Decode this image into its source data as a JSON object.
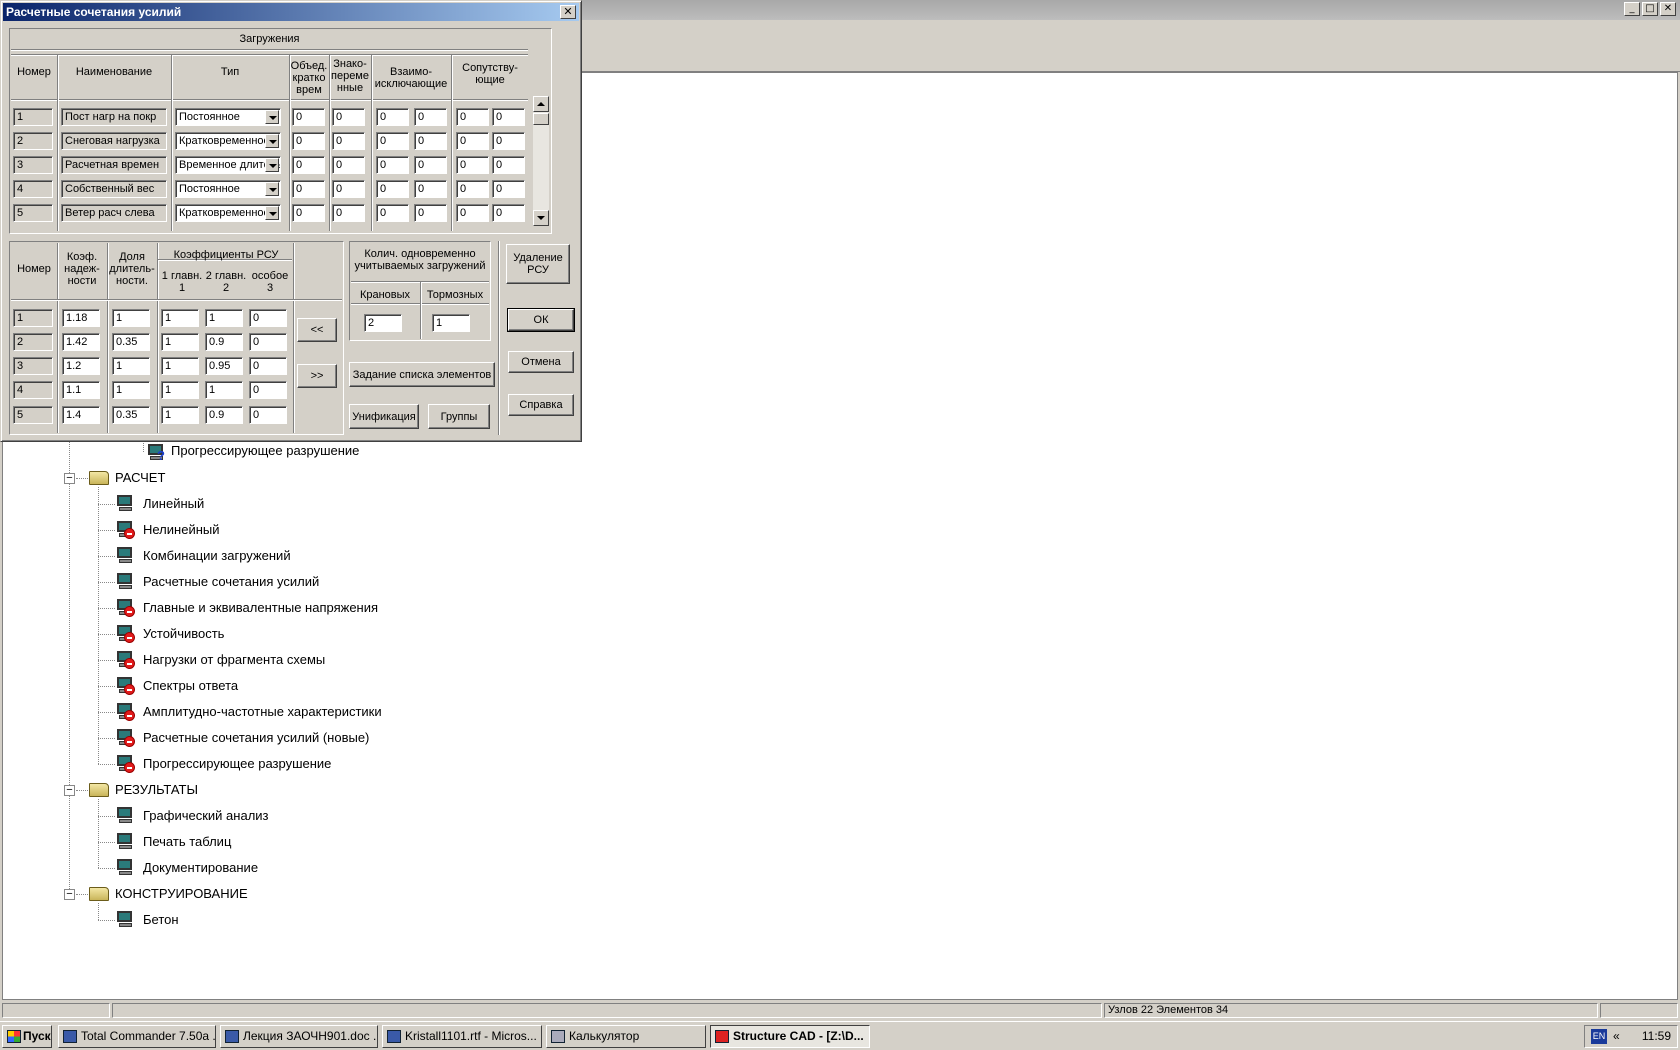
{
  "dialog": {
    "title": "Расчетные сочетания усилий",
    "close_glyph": "✕",
    "loads_group": "Загружения",
    "loads_headers": {
      "num": "Номер",
      "name": "Наименование",
      "type": "Тип",
      "combined": [
        "Объед.",
        "кратко",
        "врем"
      ],
      "alternating": [
        "Знако-",
        "переме",
        "нные"
      ],
      "mutual": [
        "Взаимо-",
        "исключающие"
      ],
      "accompanying": [
        "Сопутству-",
        "ющие"
      ]
    },
    "loads": [
      {
        "num": "1",
        "name": "Пост нагр на покр",
        "type": "Постоянное",
        "c1": "0",
        "c2": "0",
        "c3": "0",
        "c4": "0",
        "c5": "0",
        "c6": "0"
      },
      {
        "num": "2",
        "name": "Снеговая нагрузка",
        "type": "Кратковременное",
        "c1": "0",
        "c2": "0",
        "c3": "0",
        "c4": "0",
        "c5": "0",
        "c6": "0"
      },
      {
        "num": "3",
        "name": "Расчетная времен",
        "type": "Временное длительное",
        "c1": "0",
        "c2": "0",
        "c3": "0",
        "c4": "0",
        "c5": "0",
        "c6": "0"
      },
      {
        "num": "4",
        "name": "Собственный вес",
        "type": "Постоянное",
        "c1": "0",
        "c2": "0",
        "c3": "0",
        "c4": "0",
        "c5": "0",
        "c6": "0"
      },
      {
        "num": "5",
        "name": "Ветер расч слева",
        "type": "Кратковременное",
        "c1": "0",
        "c2": "0",
        "c3": "0",
        "c4": "0",
        "c5": "0",
        "c6": "0"
      }
    ],
    "coef_headers": {
      "num": "Номер",
      "reliability": [
        "Коэф.",
        "надеж-",
        "ности"
      ],
      "duration": [
        "Доля",
        "длитель-",
        "ности."
      ],
      "rsu_group": "Коэффициенты РСУ",
      "main1": [
        "1 главн.",
        "1"
      ],
      "main2": [
        "2 главн.",
        "2"
      ],
      "special": [
        "особое",
        "3"
      ]
    },
    "coefs": [
      {
        "num": "1",
        "rel": "1.18",
        "dur": "1",
        "k1": "1",
        "k2": "1",
        "k3": "0"
      },
      {
        "num": "2",
        "rel": "1.42",
        "dur": "0.35",
        "k1": "1",
        "k2": "0.9",
        "k3": "0"
      },
      {
        "num": "3",
        "rel": "1.2",
        "dur": "1",
        "k1": "1",
        "k2": "0.95",
        "k3": "0"
      },
      {
        "num": "4",
        "rel": "1.1",
        "dur": "1",
        "k1": "1",
        "k2": "1",
        "k3": "0"
      },
      {
        "num": "5",
        "rel": "1.4",
        "dur": "0.35",
        "k1": "1",
        "k2": "0.9",
        "k3": "0"
      }
    ],
    "prev_label": "<<",
    "next_label": ">>",
    "simul": {
      "title": [
        "Колич. одновременно",
        "учитываемых загружений"
      ],
      "crane_label": "Крановых",
      "brake_label": "Тормозных",
      "crane_value": "2",
      "brake_value": "1"
    },
    "elements_button": "Задание списка элементов",
    "unify_button": "Унификация",
    "groups_button": "Группы",
    "delete_button": [
      "Удаление",
      "РСУ"
    ],
    "ok_button": "ОК",
    "cancel_button": "Отмена",
    "help_button": "Справка"
  },
  "tree": {
    "top_item": "Прогрессирующее разрушение",
    "sections": [
      {
        "label": "РАСЧЕТ",
        "items": [
          {
            "label": "Линейный",
            "state": "ok"
          },
          {
            "label": "Нелинейный",
            "state": "disabled"
          },
          {
            "label": "Комбинации загружений",
            "state": "ok"
          },
          {
            "label": "Расчетные сочетания усилий",
            "state": "ok"
          },
          {
            "label": "Главные и эквивалентные напряжения",
            "state": "disabled"
          },
          {
            "label": "Устойчивость",
            "state": "disabled"
          },
          {
            "label": "Нагрузки от фрагмента схемы",
            "state": "disabled"
          },
          {
            "label": "Спектры ответа",
            "state": "disabled"
          },
          {
            "label": "Амплитудно-частотные характеристики",
            "state": "disabled"
          },
          {
            "label": "Расчетные сочетания усилий (новые)",
            "state": "disabled"
          },
          {
            "label": "Прогрессирующее разрушение",
            "state": "disabled"
          }
        ]
      },
      {
        "label": "РЕЗУЛЬТАТЫ",
        "items": [
          {
            "label": "Графический анализ",
            "state": "ok"
          },
          {
            "label": "Печать таблиц",
            "state": "ok"
          },
          {
            "label": "Документирование",
            "state": "ok"
          }
        ]
      },
      {
        "label": "КОНСТРУИРОВАНИЕ",
        "items": [
          {
            "label": "Бетон",
            "state": "ok"
          }
        ]
      }
    ]
  },
  "statusbar": {
    "info": "Узлов 22 Элементов 34"
  },
  "taskbar": {
    "start": "Пуск",
    "tasks": [
      {
        "label": "Total Commander 7.50a ..."
      },
      {
        "label": "Лекция ЗАОЧН901.doc ..."
      },
      {
        "label": "Kristall1101.rtf - Micros..."
      },
      {
        "label": "Калькулятор"
      },
      {
        "label": "Structure CAD  - [Z:\\D..."
      }
    ],
    "lang": "EN",
    "chevron": "«",
    "clock": "11:59"
  },
  "window_buttons": [
    "_",
    "□",
    "✕"
  ]
}
